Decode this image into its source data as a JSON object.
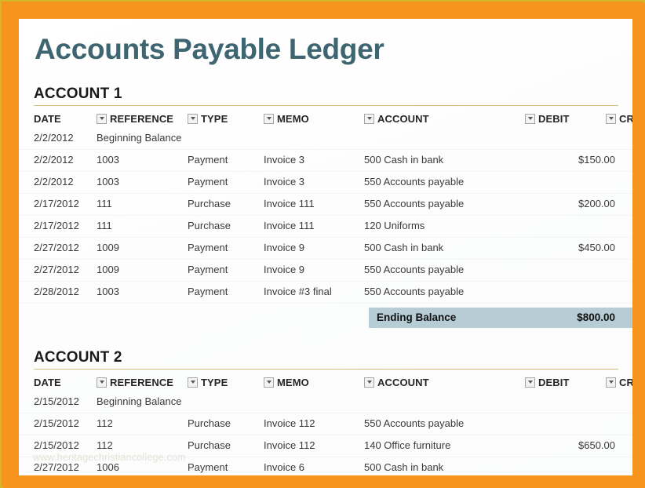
{
  "document": {
    "title": "Accounts Payable Ledger",
    "title_color": "#3d6671",
    "border_color": "#f7941e",
    "outer_edge_color": "#d4b62a",
    "accent_rule_color": "#d8bb7d",
    "ending_band_color": "#b6cdd5"
  },
  "watermark": {
    "text": "www.heritagechristiancollege.com"
  },
  "columns": [
    {
      "key": "date",
      "label": "DATE",
      "has_filter": false
    },
    {
      "key": "reference",
      "label": "REFERENCE",
      "has_filter": true
    },
    {
      "key": "type",
      "label": "TYPE",
      "has_filter": true
    },
    {
      "key": "memo",
      "label": "MEMO",
      "has_filter": true
    },
    {
      "key": "account",
      "label": "ACCOUNT",
      "has_filter": true
    },
    {
      "key": "debit",
      "label": "DEBIT",
      "has_filter": true
    },
    {
      "key": "credit",
      "label": "CREDI",
      "has_filter": true
    }
  ],
  "sections": [
    {
      "heading": "ACCOUNT 1",
      "rows": [
        {
          "date": "2/2/2012",
          "reference": "Beginning Balance",
          "type": "",
          "memo": "",
          "account": "",
          "debit": "",
          "credit": ""
        },
        {
          "date": "2/2/2012",
          "reference": "1003",
          "type": "Payment",
          "memo": "Invoice 3",
          "account": "500 Cash in bank",
          "debit": "$150.00",
          "credit": ""
        },
        {
          "date": "2/2/2012",
          "reference": "1003",
          "type": "Payment",
          "memo": "Invoice 3",
          "account": "550 Accounts payable",
          "debit": "",
          "credit": ""
        },
        {
          "date": "2/17/2012",
          "reference": "111",
          "type": "Purchase",
          "memo": "Invoice 111",
          "account": "550 Accounts payable",
          "debit": "$200.00",
          "credit": ""
        },
        {
          "date": "2/17/2012",
          "reference": "111",
          "type": "Purchase",
          "memo": "Invoice 111",
          "account": "120 Uniforms",
          "debit": "",
          "credit": ""
        },
        {
          "date": "2/27/2012",
          "reference": "1009",
          "type": "Payment",
          "memo": "Invoice 9",
          "account": "500 Cash in bank",
          "debit": "$450.00",
          "credit": ""
        },
        {
          "date": "2/27/2012",
          "reference": "1009",
          "type": "Payment",
          "memo": "Invoice 9",
          "account": "550 Accounts payable",
          "debit": "",
          "credit": ""
        },
        {
          "date": "2/28/2012",
          "reference": "1003",
          "type": "Payment",
          "memo": "Invoice #3 final",
          "account": "550 Accounts payable",
          "debit": "",
          "credit": ""
        }
      ],
      "ending_balance": {
        "label": "Ending Balance",
        "value": "$800.00"
      }
    },
    {
      "heading": "ACCOUNT 2",
      "rows": [
        {
          "date": "2/15/2012",
          "reference": "Beginning Balance",
          "type": "",
          "memo": "",
          "account": "",
          "debit": "",
          "credit": ""
        },
        {
          "date": "2/15/2012",
          "reference": "112",
          "type": "Purchase",
          "memo": "Invoice 112",
          "account": "550 Accounts payable",
          "debit": "",
          "credit": ""
        },
        {
          "date": "2/15/2012",
          "reference": "112",
          "type": "Purchase",
          "memo": "Invoice 112",
          "account": "140 Office furniture",
          "debit": "$650.00",
          "credit": ""
        },
        {
          "date": "2/27/2012",
          "reference": "1006",
          "type": "Payment",
          "memo": "Invoice 6",
          "account": "500 Cash in bank",
          "debit": "",
          "credit": ""
        }
      ],
      "ending_balance": null
    }
  ]
}
